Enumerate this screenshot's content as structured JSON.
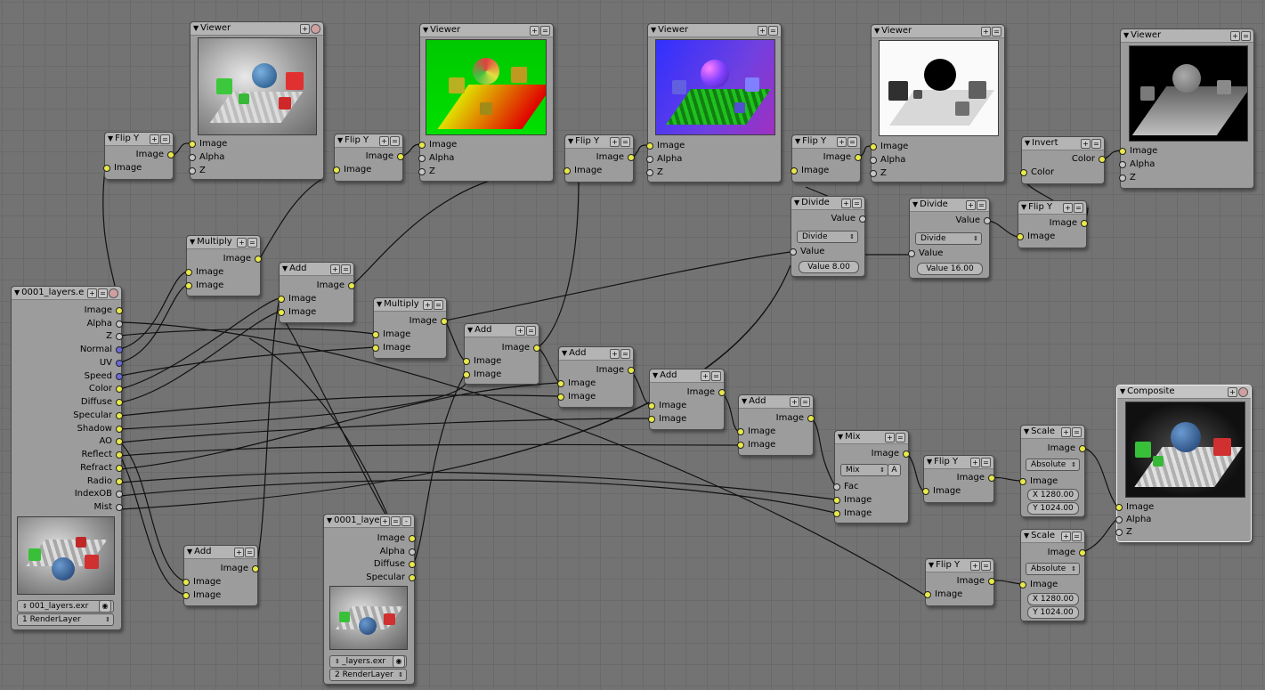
{
  "nodes": {
    "flip1": {
      "title": "Flip Y",
      "in": "Image",
      "out": "Image"
    },
    "viewer1": {
      "title": "Viewer",
      "inputs": [
        "Image",
        "Alpha",
        "Z"
      ]
    },
    "flip2": {
      "title": "Flip Y",
      "in": "Image",
      "out": "Image"
    },
    "viewer2": {
      "title": "Viewer",
      "inputs": [
        "Image",
        "Alpha",
        "Z"
      ]
    },
    "flip3": {
      "title": "Flip Y",
      "in": "Image",
      "out": "Image"
    },
    "viewer3": {
      "title": "Viewer",
      "inputs": [
        "Image",
        "Alpha",
        "Z"
      ]
    },
    "flip4": {
      "title": "Flip Y",
      "in": "Image",
      "out": "Image"
    },
    "viewer4": {
      "title": "Viewer",
      "inputs": [
        "Image",
        "Alpha",
        "Z"
      ]
    },
    "invert": {
      "title": "Invert",
      "in": "Color",
      "out": "Color"
    },
    "viewer5": {
      "title": "Viewer",
      "inputs": [
        "Image",
        "Alpha",
        "Z"
      ]
    },
    "divide1": {
      "title": "Divide",
      "out": "Value",
      "op": "Divide",
      "in": "Value",
      "field": "Value 8.00"
    },
    "divide2": {
      "title": "Divide",
      "out": "Value",
      "op": "Divide",
      "in": "Value",
      "field": "Value 16.00"
    },
    "flip5": {
      "title": "Flip Y",
      "in": "Image",
      "out": "Image"
    },
    "multiply1": {
      "title": "Multiply",
      "out": "Image",
      "inputs": [
        "Image",
        "Image"
      ]
    },
    "add1": {
      "title": "Add",
      "out": "Image",
      "inputs": [
        "Image",
        "Image"
      ]
    },
    "multiply2": {
      "title": "Multiply",
      "out": "Image",
      "inputs": [
        "Image",
        "Image"
      ]
    },
    "add2": {
      "title": "Add",
      "out": "Image",
      "inputs": [
        "Image",
        "Image"
      ]
    },
    "add3": {
      "title": "Add",
      "out": "Image",
      "inputs": [
        "Image",
        "Image"
      ]
    },
    "add4": {
      "title": "Add",
      "out": "Image",
      "inputs": [
        "Image",
        "Image"
      ]
    },
    "add5": {
      "title": "Add",
      "out": "Image",
      "inputs": [
        "Image",
        "Image"
      ]
    },
    "mix": {
      "title": "Mix",
      "out": "Image",
      "op": "Mix",
      "alpha_btn": "A",
      "inputs": [
        "Fac",
        "Image",
        "Image"
      ]
    },
    "flip6": {
      "title": "Flip Y",
      "in": "Image",
      "out": "Image"
    },
    "scale1": {
      "title": "Scale",
      "out": "Image",
      "op": "Absolute",
      "in": "Image",
      "x": "X 1280.00",
      "y": "Y 1024.00"
    },
    "composite": {
      "title": "Composite",
      "inputs": [
        "Image",
        "Alpha",
        "Z"
      ]
    },
    "flip7": {
      "title": "Flip Y",
      "in": "Image",
      "out": "Image"
    },
    "scale2": {
      "title": "Scale",
      "out": "Image",
      "op": "Absolute",
      "in": "Image",
      "x": "X 1280.00",
      "y": "Y 1024.00"
    },
    "add6": {
      "title": "Add",
      "out": "Image",
      "inputs": [
        "Image",
        "Image"
      ]
    },
    "layers1": {
      "title": "0001_layers.e",
      "outputs": [
        "Image",
        "Alpha",
        "Z",
        "Normal",
        "UV",
        "Speed",
        "Color",
        "Diffuse",
        "Specular",
        "Shadow",
        "AO",
        "Reflect",
        "Refract",
        "Radio",
        "IndexOB",
        "Mist"
      ],
      "file": "001_layers.exr",
      "layer": "1 RenderLayer"
    },
    "layers2": {
      "title": "0001_laye",
      "outputs": [
        "Image",
        "Alpha",
        "Diffuse",
        "Specular"
      ],
      "file": "_layers.exr",
      "layer": "2 RenderLayer"
    }
  },
  "colors": {
    "background": "#737373",
    "node_body": "#9c9c9c",
    "socket_color": "#e8e84a",
    "socket_value": "#c6c6c6",
    "socket_vector": "#6a6ad8"
  }
}
